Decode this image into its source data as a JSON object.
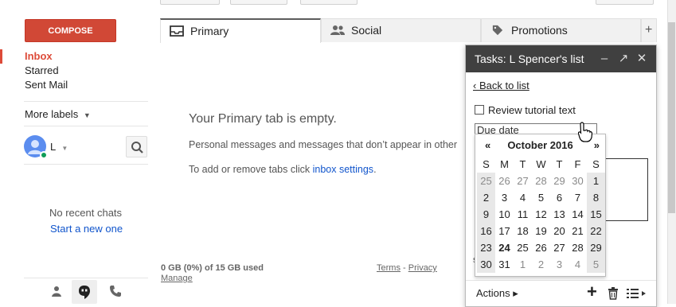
{
  "left_nav": {
    "compose_label": "COMPOSE",
    "items": [
      {
        "label": "Inbox",
        "active": true
      },
      {
        "label": "Starred"
      },
      {
        "label": "Sent Mail"
      }
    ],
    "more_labels": "More labels",
    "user_initial": "L",
    "no_recent_chats": "No recent chats",
    "start_new_chat": "Start a new one"
  },
  "tabs": [
    {
      "label": "Primary",
      "icon": "inbox-icon",
      "selected": true
    },
    {
      "label": "Social",
      "icon": "people-icon"
    },
    {
      "label": "Promotions",
      "icon": "tag-icon"
    }
  ],
  "add_tab_label": "+",
  "main": {
    "empty_title": "Your Primary tab is empty.",
    "empty_desc": "Personal messages and messages that don’t appear in other",
    "tabs_hint_prefix": "To add or remove tabs click ",
    "tabs_hint_link": "inbox settings",
    "tabs_hint_suffix": "."
  },
  "footer": {
    "storage": "0 GB (0%) of 15 GB used",
    "manage": "Manage",
    "terms": "Terms",
    "sep": "-",
    "privacy": "Privacy"
  },
  "tasks": {
    "title": "Tasks: L Spencer's list",
    "back_label": "‹ Back to list",
    "task_label": "Review tutorial text",
    "due_placeholder": "Due date",
    "actions_label": "Actions ▸"
  },
  "calendar": {
    "month_label": "October 2016",
    "prev": "«",
    "next": "»",
    "weekdays": [
      "S",
      "M",
      "T",
      "W",
      "T",
      "F",
      "S"
    ],
    "weeks": [
      [
        "25",
        "26",
        "27",
        "28",
        "29",
        "30",
        "1"
      ],
      [
        "2",
        "3",
        "4",
        "5",
        "6",
        "7",
        "8"
      ],
      [
        "9",
        "10",
        "11",
        "12",
        "13",
        "14",
        "15"
      ],
      [
        "16",
        "17",
        "18",
        "19",
        "20",
        "21",
        "22"
      ],
      [
        "23",
        "24",
        "25",
        "26",
        "27",
        "28",
        "29"
      ],
      [
        "30",
        "31",
        "1",
        "2",
        "3",
        "4",
        "5"
      ]
    ],
    "today": "24"
  },
  "colors": {
    "accent": "#dd4b39",
    "link": "#1155cc",
    "header": "#404040"
  }
}
